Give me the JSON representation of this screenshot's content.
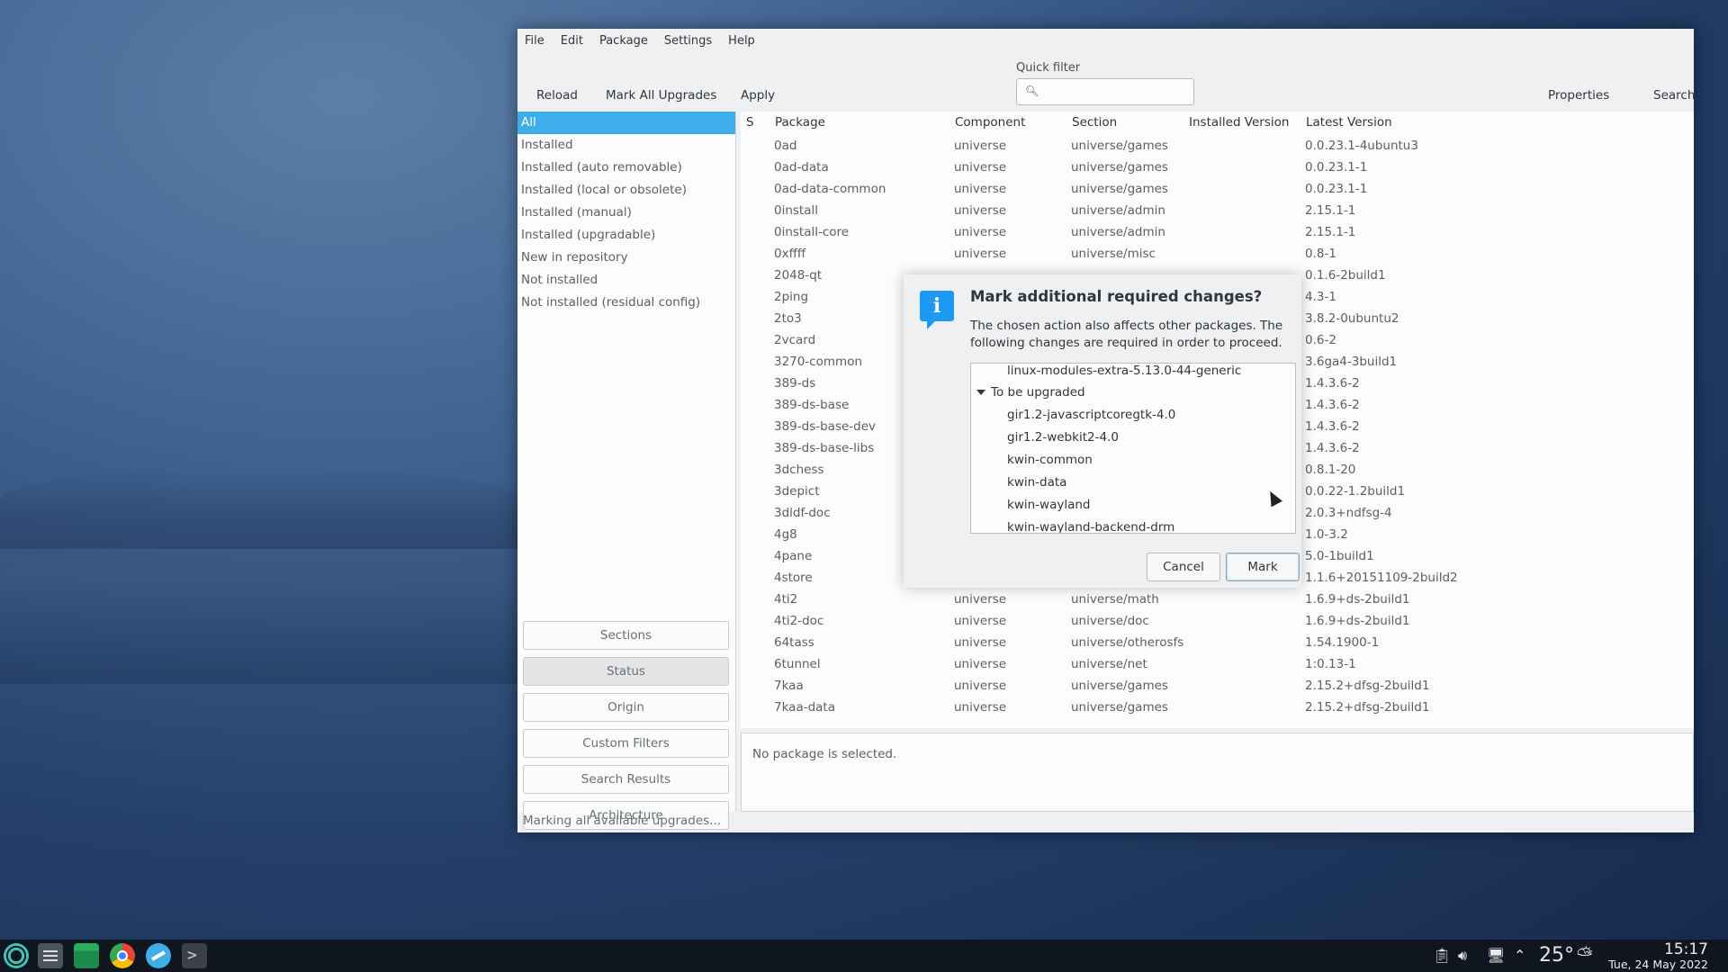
{
  "menu": [
    "File",
    "Edit",
    "Package",
    "Settings",
    "Help"
  ],
  "toolbar": {
    "reload": "Reload",
    "mark_all": "Mark All Upgrades",
    "apply": "Apply",
    "quick_filter_label": "Quick filter",
    "quick_filter_value": "",
    "properties": "Properties",
    "search": "Search"
  },
  "filters": [
    "All",
    "Installed",
    "Installed (auto removable)",
    "Installed (local or obsolete)",
    "Installed (manual)",
    "Installed (upgradable)",
    "New in repository",
    "Not installed",
    "Not installed (residual config)"
  ],
  "filter_selected": "All",
  "pane_buttons": [
    "Sections",
    "Status",
    "Origin",
    "Custom Filters",
    "Search Results",
    "Architecture"
  ],
  "columns": [
    "S",
    "Package",
    "Component",
    "Section",
    "Installed Version",
    "Latest Version"
  ],
  "packages": [
    {
      "name": "0ad",
      "component": "universe",
      "section": "universe/games",
      "latest": "0.0.23.1-4ubuntu3"
    },
    {
      "name": "0ad-data",
      "component": "universe",
      "section": "universe/games",
      "latest": "0.0.23.1-1"
    },
    {
      "name": "0ad-data-common",
      "component": "universe",
      "section": "universe/games",
      "latest": "0.0.23.1-1"
    },
    {
      "name": "0install",
      "component": "universe",
      "section": "universe/admin",
      "latest": "2.15.1-1"
    },
    {
      "name": "0install-core",
      "component": "universe",
      "section": "universe/admin",
      "latest": "2.15.1-1"
    },
    {
      "name": "0xffff",
      "component": "universe",
      "section": "universe/misc",
      "latest": "0.8-1"
    },
    {
      "name": "2048-qt",
      "component": "",
      "section": "",
      "latest": "0.1.6-2build1"
    },
    {
      "name": "2ping",
      "component": "",
      "section": "",
      "latest": "4.3-1"
    },
    {
      "name": "2to3",
      "component": "",
      "section": "",
      "latest": "3.8.2-0ubuntu2"
    },
    {
      "name": "2vcard",
      "component": "",
      "section": "",
      "latest": "0.6-2"
    },
    {
      "name": "3270-common",
      "component": "",
      "section": "",
      "latest": "3.6ga4-3build1"
    },
    {
      "name": "389-ds",
      "component": "",
      "section": "",
      "latest": "1.4.3.6-2"
    },
    {
      "name": "389-ds-base",
      "component": "",
      "section": "",
      "latest": "1.4.3.6-2"
    },
    {
      "name": "389-ds-base-dev",
      "component": "",
      "section": "",
      "latest": "1.4.3.6-2"
    },
    {
      "name": "389-ds-base-libs",
      "component": "",
      "section": "",
      "latest": "1.4.3.6-2"
    },
    {
      "name": "3dchess",
      "component": "",
      "section": "",
      "latest": "0.8.1-20"
    },
    {
      "name": "3depict",
      "component": "",
      "section": "",
      "latest": "0.0.22-1.2build1"
    },
    {
      "name": "3dldf-doc",
      "component": "",
      "section": "",
      "latest": "2.0.3+ndfsg-4"
    },
    {
      "name": "4g8",
      "component": "",
      "section": "",
      "latest": "1.0-3.2"
    },
    {
      "name": "4pane",
      "component": "",
      "section": "",
      "latest": "5.0-1build1"
    },
    {
      "name": "4store",
      "component": "",
      "section": "",
      "latest": "1.1.6+20151109-2build2"
    },
    {
      "name": "4ti2",
      "component": "universe",
      "section": "universe/math",
      "latest": "1.6.9+ds-2build1"
    },
    {
      "name": "4ti2-doc",
      "component": "universe",
      "section": "universe/doc",
      "latest": "1.6.9+ds-2build1"
    },
    {
      "name": "64tass",
      "component": "universe",
      "section": "universe/otherosfs",
      "latest": "1.54.1900-1"
    },
    {
      "name": "6tunnel",
      "component": "universe",
      "section": "universe/net",
      "latest": "1:0.13-1"
    },
    {
      "name": "7kaa",
      "component": "universe",
      "section": "universe/games",
      "latest": "2.15.2+dfsg-2build1"
    },
    {
      "name": "7kaa-data",
      "component": "universe",
      "section": "universe/games",
      "latest": "2.15.2+dfsg-2build1"
    }
  ],
  "details": "No package is selected.",
  "status": "Marking all available upgrades...",
  "dialog": {
    "title": "Mark additional required changes?",
    "text": "The chosen action also affects other packages. The following changes are required in order to proceed.",
    "top_item": "linux-modules-extra-5.13.0-44-generic",
    "group": "To be upgraded",
    "items": [
      "gir1.2-javascriptcoregtk-4.0",
      "gir1.2-webkit2-4.0",
      "kwin-common",
      "kwin-data",
      "kwin-wayland",
      "kwin-wayland-backend-drm"
    ],
    "cancel": "Cancel",
    "mark": "Mark"
  },
  "tray": {
    "temperature": "25°",
    "time": "15:17",
    "date": "Tue, 24 May 2022"
  },
  "taskbar_icons": [
    "app-launcher-icon",
    "settings-manager-icon",
    "file-manager-icon",
    "chrome-icon",
    "software-icon",
    "terminal-icon"
  ]
}
